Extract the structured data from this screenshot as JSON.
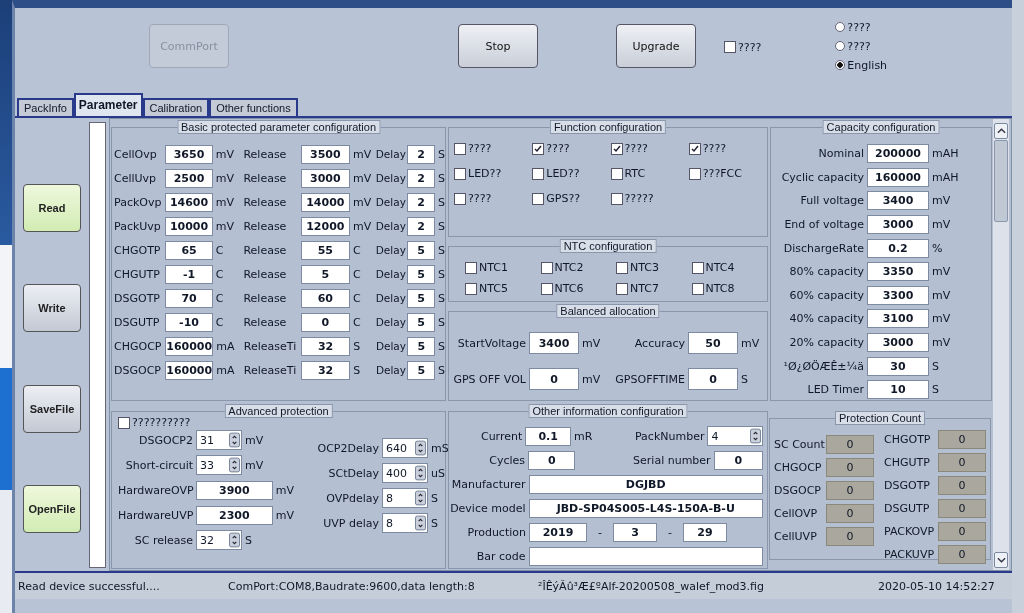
{
  "toolbar": {
    "buttons": [
      {
        "label": "CommPort",
        "disabled": true
      },
      {
        "label": "Stop",
        "disabled": false
      },
      {
        "label": "Upgrade",
        "disabled": false
      }
    ],
    "checkbox": {
      "label": "????",
      "checked": false
    },
    "languages": [
      {
        "label": "????",
        "selected": false
      },
      {
        "label": "????",
        "selected": false
      },
      {
        "label": "English",
        "selected": true
      }
    ]
  },
  "tabs": [
    {
      "label": "PackInfo",
      "selected": false
    },
    {
      "label": "Parameter",
      "selected": true
    },
    {
      "label": "Calibration",
      "selected": false
    },
    {
      "label": "Other functions",
      "selected": false
    }
  ],
  "side_buttons": [
    {
      "label": "Read",
      "highlighted": true
    },
    {
      "label": "Write",
      "highlighted": false
    },
    {
      "label": "SaveFile",
      "highlighted": false
    },
    {
      "label": "OpenFile",
      "highlighted": true
    }
  ],
  "progress": {
    "level": 0
  },
  "basic": {
    "title": "Basic protected parameter configuration",
    "rows": [
      {
        "name": "CellOvp",
        "value": "3650",
        "unit": "mV",
        "release_label": "Release",
        "release_value": "3500",
        "release_unit": "mV",
        "delay_label": "Delay",
        "delay_value": "2",
        "delay_unit": "S"
      },
      {
        "name": "CellUvp",
        "value": "2500",
        "unit": "mV",
        "release_label": "Release",
        "release_value": "3000",
        "release_unit": "mV",
        "delay_label": "Delay",
        "delay_value": "2",
        "delay_unit": "S"
      },
      {
        "name": "PackOvp",
        "value": "14600",
        "unit": "mV",
        "release_label": "Release",
        "release_value": "14000",
        "release_unit": "mV",
        "delay_label": "Delay",
        "delay_value": "2",
        "delay_unit": "S"
      },
      {
        "name": "PackUvp",
        "value": "10000",
        "unit": "mV",
        "release_label": "Release",
        "release_value": "12000",
        "release_unit": "mV",
        "delay_label": "Delay",
        "delay_value": "2",
        "delay_unit": "S"
      },
      {
        "name": "CHGOTP",
        "value": "65",
        "unit": "C",
        "release_label": "Release",
        "release_value": "55",
        "release_unit": "C",
        "delay_label": "Delay",
        "delay_value": "5",
        "delay_unit": "S"
      },
      {
        "name": "CHGUTP",
        "value": "-1",
        "unit": "C",
        "release_label": "Release",
        "release_value": "5",
        "release_unit": "C",
        "delay_label": "Delay",
        "delay_value": "5",
        "delay_unit": "S"
      },
      {
        "name": "DSGOTP",
        "value": "70",
        "unit": "C",
        "release_label": "Release",
        "release_value": "60",
        "release_unit": "C",
        "delay_label": "Delay",
        "delay_value": "5",
        "delay_unit": "S"
      },
      {
        "name": "DSGUTP",
        "value": "-10",
        "unit": "C",
        "release_label": "Release",
        "release_value": "0",
        "release_unit": "C",
        "delay_label": "Delay",
        "delay_value": "5",
        "delay_unit": "S"
      },
      {
        "name": "CHGOCP",
        "value": "160000",
        "unit": "mA",
        "release_label": "ReleaseTi",
        "release_value": "32",
        "release_unit": "S",
        "delay_label": "Delay",
        "delay_value": "5",
        "delay_unit": "S"
      },
      {
        "name": "DSGOCP",
        "value": "160000",
        "unit": "mA",
        "release_label": "ReleaseTi",
        "release_value": "32",
        "release_unit": "S",
        "delay_label": "Delay",
        "delay_value": "5",
        "delay_unit": "S"
      }
    ]
  },
  "functions": {
    "title": "Function configuration",
    "items": [
      {
        "label": "????",
        "checked": false
      },
      {
        "label": "????",
        "checked": true
      },
      {
        "label": "????",
        "checked": true
      },
      {
        "label": "????",
        "checked": true
      },
      {
        "label": "LED??",
        "checked": false
      },
      {
        "label": "LED??",
        "checked": false
      },
      {
        "label": "RTC",
        "checked": false
      },
      {
        "label": "???FCC",
        "checked": false
      },
      {
        "label": "????",
        "checked": false
      },
      {
        "label": "GPS??",
        "checked": false
      },
      {
        "label": "?????",
        "checked": false
      }
    ]
  },
  "ntc": {
    "title": "NTC configuration",
    "items": [
      {
        "label": "NTC1",
        "checked": false
      },
      {
        "label": "NTC2",
        "checked": false
      },
      {
        "label": "NTC3",
        "checked": false
      },
      {
        "label": "NTC4",
        "checked": false
      },
      {
        "label": "NTC5",
        "checked": false
      },
      {
        "label": "NTC6",
        "checked": false
      },
      {
        "label": "NTC7",
        "checked": false
      },
      {
        "label": "NTC8",
        "checked": false
      }
    ]
  },
  "balanced": {
    "title": "Balanced allocation",
    "fields": [
      {
        "label": "StartVoltage",
        "value": "3400",
        "unit": "mV"
      },
      {
        "label": "Accuracy",
        "value": "50",
        "unit": "mV"
      },
      {
        "label": "GPS OFF VOL",
        "value": "0",
        "unit": "mV"
      },
      {
        "label": "GPSOFFTIME",
        "value": "0",
        "unit": "S"
      }
    ]
  },
  "capacity": {
    "title": "Capacity configuration",
    "fields": [
      {
        "label": "Nominal",
        "value": "200000",
        "unit": "mAH"
      },
      {
        "label": "Cyclic capacity",
        "value": "160000",
        "unit": "mAH"
      },
      {
        "label": "Full voltage",
        "value": "3400",
        "unit": "mV"
      },
      {
        "label": "End of voltage",
        "value": "3000",
        "unit": "mV"
      },
      {
        "label": "DischargeRate",
        "value": "0.2",
        "unit": "%"
      },
      {
        "label": "80% capacity",
        "value": "3350",
        "unit": "mV"
      },
      {
        "label": "60% capacity",
        "value": "3300",
        "unit": "mV"
      },
      {
        "label": "40% capacity",
        "value": "3100",
        "unit": "mV"
      },
      {
        "label": "20% capacity",
        "value": "3000",
        "unit": "mV"
      },
      {
        "label": "¹Ø¿ØÖÆÊ±¼ä",
        "value": "30",
        "unit": "S"
      },
      {
        "label": "LED Timer",
        "value": "10",
        "unit": "S"
      }
    ]
  },
  "advanced": {
    "title": "Advanced protection",
    "checkbox": {
      "label": "??????????",
      "checked": false
    },
    "left": [
      {
        "label": "DSGOCP2",
        "value": "31",
        "unit": "mV",
        "kind": "spin"
      },
      {
        "label": "Short-circuit",
        "value": "33",
        "unit": "mV",
        "kind": "spin"
      },
      {
        "label": "HardwareOVP",
        "value": "3900",
        "unit": "mV",
        "kind": "text"
      },
      {
        "label": "HardwareUVP",
        "value": "2300",
        "unit": "mV",
        "kind": "text"
      },
      {
        "label": "SC release",
        "value": "32",
        "unit": "S",
        "kind": "spin"
      }
    ],
    "right": [
      {
        "label": "OCP2Delay",
        "value": "640",
        "unit": "mS",
        "kind": "spin"
      },
      {
        "label": "SCtDelay",
        "value": "400",
        "unit": "uS",
        "kind": "spin"
      },
      {
        "label": "OVPdelay",
        "value": "8",
        "unit": "S",
        "kind": "spin"
      },
      {
        "label": "UVP delay",
        "value": "8",
        "unit": "S",
        "kind": "spin"
      }
    ]
  },
  "other": {
    "title": "Other information configuration",
    "current": {
      "label": "Current",
      "value": "0.1",
      "unit": "mR"
    },
    "pack_number": {
      "label": "PackNumber",
      "value": "4"
    },
    "cycles": {
      "label": "Cycles",
      "value": "0"
    },
    "serial": {
      "label": "Serial number",
      "value": "0"
    },
    "manufacturer": {
      "label": "Manufacturer",
      "value": "DGJBD"
    },
    "device_model": {
      "label": "Device model",
      "value": "JBD-SP04S005-L4S-150A-B-U"
    },
    "production": {
      "label": "Production",
      "year": "2019",
      "month": "3",
      "day": "29",
      "separator": "-"
    },
    "bar_code": {
      "label": "Bar code"
    }
  },
  "protection_count": {
    "title": "Protection Count",
    "left": [
      {
        "label": "SC Count",
        "value": "0"
      },
      {
        "label": "CHGOCP",
        "value": "0"
      },
      {
        "label": "DSGOCP",
        "value": "0"
      },
      {
        "label": "CellOVP",
        "value": "0"
      },
      {
        "label": "CellUVP",
        "value": "0"
      }
    ],
    "right": [
      {
        "label": "CHGOTP",
        "value": "0"
      },
      {
        "label": "CHGUTP",
        "value": "0"
      },
      {
        "label": "DSGOTP",
        "value": "0"
      },
      {
        "label": "DSGUTP",
        "value": "0"
      },
      {
        "label": "PACKOVP",
        "value": "0"
      },
      {
        "label": "PACKUVP",
        "value": "0"
      }
    ]
  },
  "status_bar": [
    "Read device successful....",
    "ComPort:COM8,Baudrate:9600,data length:8",
    "²ÎÊýÃû³Æ£ºAlf-20200508_walef_mod3.fig",
    "2020-05-10 14:52:27"
  ]
}
